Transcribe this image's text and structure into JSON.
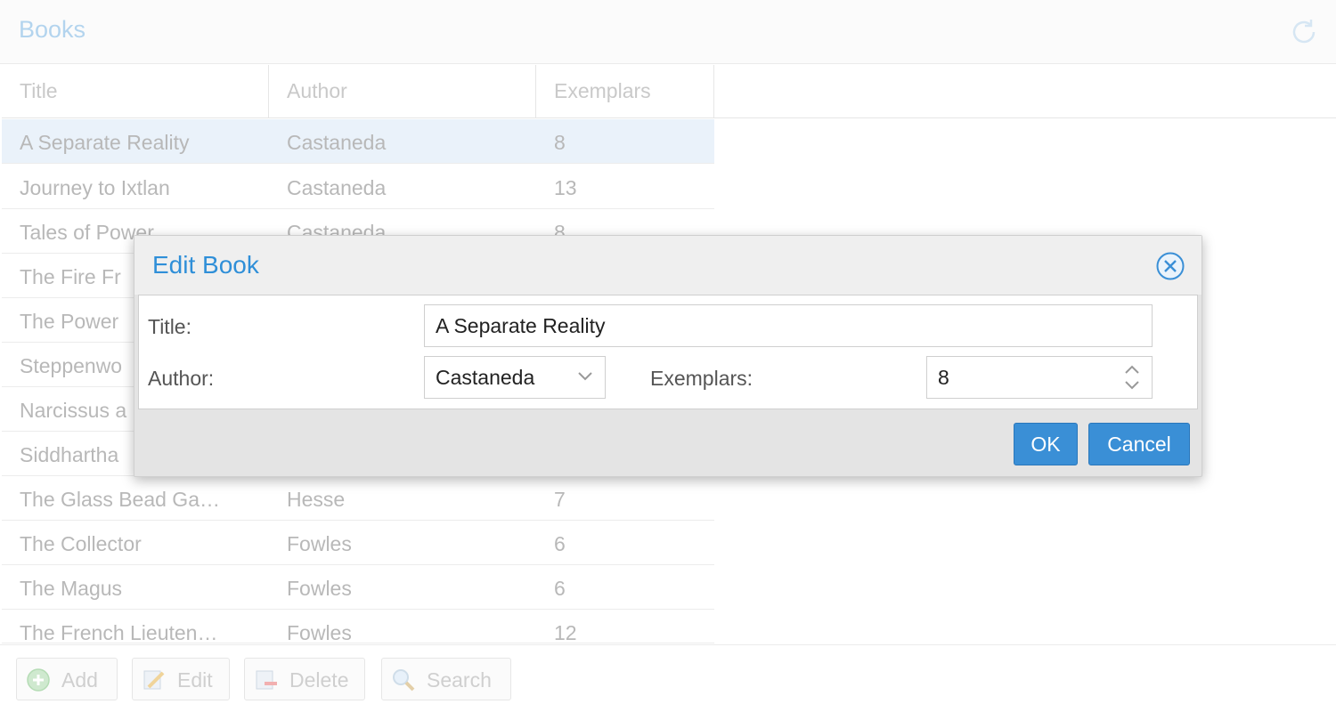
{
  "window": {
    "title": "Books"
  },
  "grid": {
    "columns": [
      "Title",
      "Author",
      "Exemplars"
    ],
    "rows": [
      {
        "title": "A Separate Reality",
        "author": "Castaneda",
        "exemplars": "8"
      },
      {
        "title": "Journey to Ixtlan",
        "author": "Castaneda",
        "exemplars": "13"
      },
      {
        "title": "Tales of Power",
        "author": "Castaneda",
        "exemplars": "8"
      },
      {
        "title": "The Fire Fr",
        "author": "",
        "exemplars": ""
      },
      {
        "title": "The Power",
        "author": "",
        "exemplars": ""
      },
      {
        "title": "Steppenwo",
        "author": "",
        "exemplars": ""
      },
      {
        "title": "Narcissus a",
        "author": "",
        "exemplars": ""
      },
      {
        "title": "Siddhartha",
        "author": "",
        "exemplars": ""
      },
      {
        "title": "The Glass Bead Ga…",
        "author": "Hesse",
        "exemplars": "7"
      },
      {
        "title": "The Collector",
        "author": "Fowles",
        "exemplars": "6"
      },
      {
        "title": "The Magus",
        "author": "Fowles",
        "exemplars": "6"
      },
      {
        "title": "The French Lieuten…",
        "author": "Fowles",
        "exemplars": "12"
      }
    ]
  },
  "toolbar": {
    "add": "Add",
    "edit": "Edit",
    "delete": "Delete",
    "search": "Search"
  },
  "dialog": {
    "title": "Edit Book",
    "title_label": "Title:",
    "title_value": "A Separate Reality",
    "author_label": "Author:",
    "author_value": "Castaneda",
    "exemplars_label": "Exemplars:",
    "exemplars_value": "8",
    "ok": "OK",
    "cancel": "Cancel"
  },
  "colors": {
    "accent": "#3a8fd6",
    "dialog_title": "#2f8fd8",
    "selected_row": "#eaf2fa"
  }
}
